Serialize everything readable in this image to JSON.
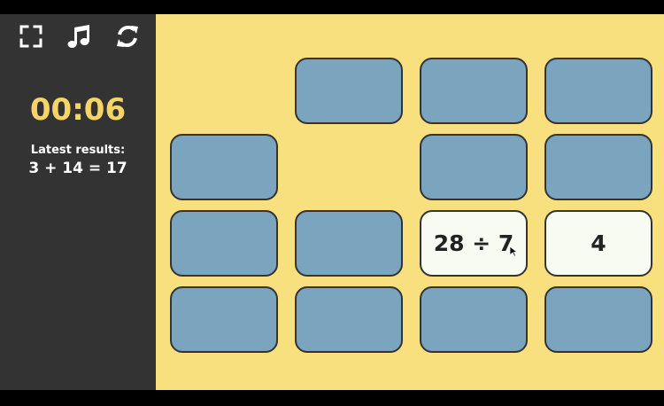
{
  "toolbar": {
    "icons": [
      "fullscreen-icon",
      "music-icon",
      "restart-icon"
    ]
  },
  "timer": "00:06",
  "latest": {
    "label": "Latest results:",
    "value": "3 + 14 = 17"
  },
  "colors": {
    "sidebar": "#333333",
    "board": "#F9E07E",
    "card_back": "#7BA4BE",
    "card_face": "#F8FBF2",
    "timer": "#F5D566"
  },
  "cards": [
    {
      "row": 0,
      "col": 0,
      "state": "removed",
      "text": ""
    },
    {
      "row": 0,
      "col": 1,
      "state": "hidden",
      "text": ""
    },
    {
      "row": 0,
      "col": 2,
      "state": "hidden",
      "text": ""
    },
    {
      "row": 0,
      "col": 3,
      "state": "hidden",
      "text": ""
    },
    {
      "row": 1,
      "col": 0,
      "state": "hidden",
      "text": ""
    },
    {
      "row": 1,
      "col": 1,
      "state": "removed",
      "text": ""
    },
    {
      "row": 1,
      "col": 2,
      "state": "hidden",
      "text": ""
    },
    {
      "row": 1,
      "col": 3,
      "state": "hidden",
      "text": ""
    },
    {
      "row": 2,
      "col": 0,
      "state": "hidden",
      "text": ""
    },
    {
      "row": 2,
      "col": 1,
      "state": "hidden",
      "text": ""
    },
    {
      "row": 2,
      "col": 2,
      "state": "face-up",
      "text": "28 ÷ 7"
    },
    {
      "row": 2,
      "col": 3,
      "state": "face-up",
      "text": "4"
    },
    {
      "row": 3,
      "col": 0,
      "state": "hidden",
      "text": ""
    },
    {
      "row": 3,
      "col": 1,
      "state": "hidden",
      "text": ""
    },
    {
      "row": 3,
      "col": 2,
      "state": "hidden",
      "text": ""
    },
    {
      "row": 3,
      "col": 3,
      "state": "hidden",
      "text": ""
    }
  ]
}
